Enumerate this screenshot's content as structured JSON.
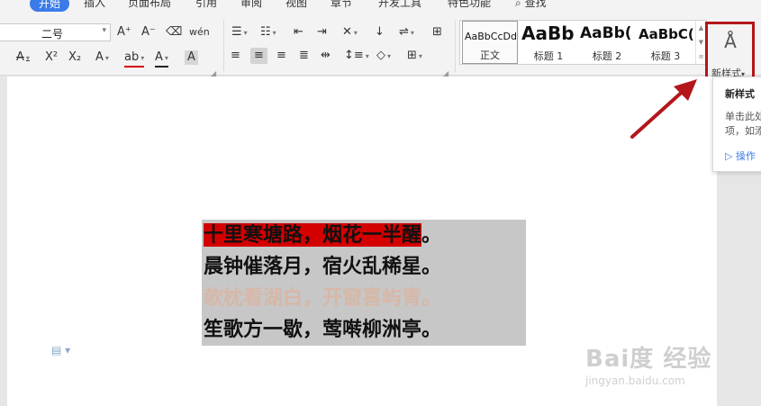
{
  "menu": {
    "tabs": [
      "开始",
      "插入",
      "页面布局",
      "引用",
      "审阅",
      "视图",
      "章节",
      "开发工具",
      "特色功能",
      "查找"
    ],
    "active": "开始",
    "accent": "#3b7be9"
  },
  "ribbon": {
    "font_size": "二号",
    "style_gallery": [
      {
        "preview": "AaBbCcDd",
        "name": "正文"
      },
      {
        "preview": "AaBb",
        "name": "标题 1"
      },
      {
        "preview": "AaBb(",
        "name": "标题 2"
      },
      {
        "preview": "AaBbC(",
        "name": "标题 3"
      }
    ],
    "new_style_label": "新样式",
    "icons": {
      "grow_font": "A⁺",
      "shrink_font": "A⁻",
      "clear_format": "⌫",
      "phonetic": "wén",
      "strikethrough": "A",
      "superscript": "X²",
      "subscript": "X₂",
      "text_effect": "A",
      "highlight": "ab",
      "font_color": "A",
      "char_shading": "A"
    }
  },
  "tooltip": {
    "title": "新样式",
    "line1": "单击此处",
    "line2": "项，如添",
    "link": "操作"
  },
  "document": {
    "poem": [
      {
        "highlighted": "十里寒塘路，烟花一半醒",
        "rest": "。"
      },
      {
        "highlighted": "",
        "rest": "晨钟催落月，宿火乱稀星。"
      },
      {
        "highlighted": "",
        "rest": "欹枕看湖白，开窗喜屿青。"
      },
      {
        "highlighted": "",
        "rest": "笙歌方一歇，莺啭柳洲亭。"
      }
    ],
    "highlight_color": "#d40000",
    "selection_color": "#c7c7c7"
  },
  "watermark": {
    "main": "Bai度 经验",
    "url": "jingyan.baidu.com"
  },
  "annotation": {
    "box_color": "#b3161b"
  }
}
